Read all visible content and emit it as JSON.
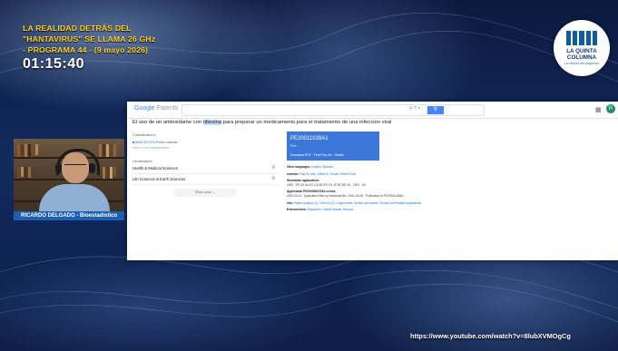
{
  "overlay": {
    "title_lines": [
      "LA REALIDAD DETRÁS DEL",
      "\"HANTAVIRUS\" SE LLAMA 26 GHz",
      "- PROGRAMA 44 - (9 mayo 2026)"
    ],
    "timer": "01:15:40",
    "channel_url": "https://www.youtube.com/watch?v=8lubXVMOgCg"
  },
  "logo": {
    "line1": "LA QUINTA",
    "line2": "COLUMNA",
    "tagline": "La ciencia del despertar"
  },
  "presenter": {
    "name": "RICARDO DELGADO - Bioestadístico"
  },
  "browser": {
    "logo_a": "Google",
    "logo_b": "Patents",
    "search_icons": "⚲ ? ×",
    "doc_title_before": "El uso de un antioxidante con ",
    "doc_title_highlight": "riboxina",
    "doc_title_after": " para preparar un medicamento para el tratamiento de una infeccion viral",
    "classifications_label": "Classifications",
    "classification_code": "A61K31/7076",
    "classification_text": "Purine radicals",
    "classification_more": "View 9 more classifications",
    "landscapes_label": "Landscapes",
    "landscapes": [
      "Health & Medical Sciences",
      "Life Sciences & Earth Sciences"
    ],
    "show_more": "Show more ⌄",
    "pub_number": "PE20011028A1",
    "pub_kind": "Peru",
    "card_links": [
      "Download PDF",
      "Find Prior Art",
      "Similar"
    ],
    "meta": [
      {
        "label": "Other languages:",
        "value": "English, Spanish"
      },
      {
        "label": "Inventor:",
        "value": "Paul M. Mai, Clifford D. Ersner, Robert Tone"
      },
      {
        "label": "Worldwide applications",
        "value": "2000 · EP US AU AT CA DE KR CN JP NZ BR ZA · 2001 · US"
      },
      {
        "label": "Application PE2000000753A events",
        "value": "2000-04-14 · Application filed by Nordmark Bio, 2001-03-08 · Publication of PE20011028A1"
      },
      {
        "label": "Info:",
        "value": "Patent citations (1), Cited by (2), Legal events, Similar documents, Priority and Related Applications"
      },
      {
        "label": "External links:",
        "value": "Espacenet, Global Dossier, Discuss"
      }
    ]
  }
}
